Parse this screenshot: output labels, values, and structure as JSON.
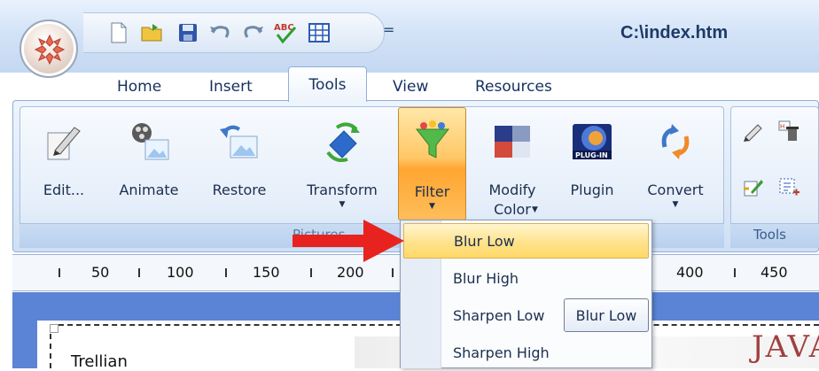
{
  "window": {
    "title": "C:\\index.htm"
  },
  "quick_access": {
    "icons": [
      "new-document-icon",
      "open-folder-icon",
      "save-icon",
      "undo-icon",
      "redo-icon",
      "spell-check-icon",
      "table-icon"
    ],
    "more_glyph": "="
  },
  "tabs": [
    {
      "label": "Home"
    },
    {
      "label": "Insert"
    },
    {
      "label": "Tools",
      "active": true
    },
    {
      "label": "View"
    },
    {
      "label": "Resources"
    }
  ],
  "ribbon": {
    "pictures_group": {
      "label": "Pictures",
      "buttons": [
        {
          "label": "Edit...",
          "icon": "edit-picture-icon"
        },
        {
          "label": "Animate",
          "icon": "animate-icon"
        },
        {
          "label": "Restore",
          "icon": "restore-icon"
        },
        {
          "label": "Transform",
          "icon": "transform-icon",
          "has_dropdown": true
        },
        {
          "label": "Filter",
          "icon": "filter-icon",
          "has_dropdown": true,
          "active": true
        },
        {
          "label": "Modify Color",
          "icon": "modify-color-icon",
          "has_dropdown": true
        },
        {
          "label": "Plugin",
          "icon": "plugin-icon"
        },
        {
          "label": "Convert",
          "icon": "convert-icon",
          "has_dropdown": true
        }
      ]
    },
    "tools_group": {
      "label": "Tools"
    }
  },
  "ruler": {
    "labels": [
      "50",
      "100",
      "150",
      "200",
      "400",
      "450"
    ]
  },
  "filter_menu": {
    "items": [
      {
        "label": "Blur Low",
        "highlighted": true
      },
      {
        "label": "Blur High"
      },
      {
        "label": "Sharpen Low"
      },
      {
        "label": "Sharpen High"
      }
    ],
    "tooltip": "Blur Low"
  },
  "document": {
    "text": "Trellian",
    "image_text": "JAVA"
  },
  "colors": {
    "accent": "#ffc766",
    "ribbon_blue": "#dde9f8",
    "arrow_red": "#e8231f",
    "doc_bg": "#5b84d6"
  }
}
